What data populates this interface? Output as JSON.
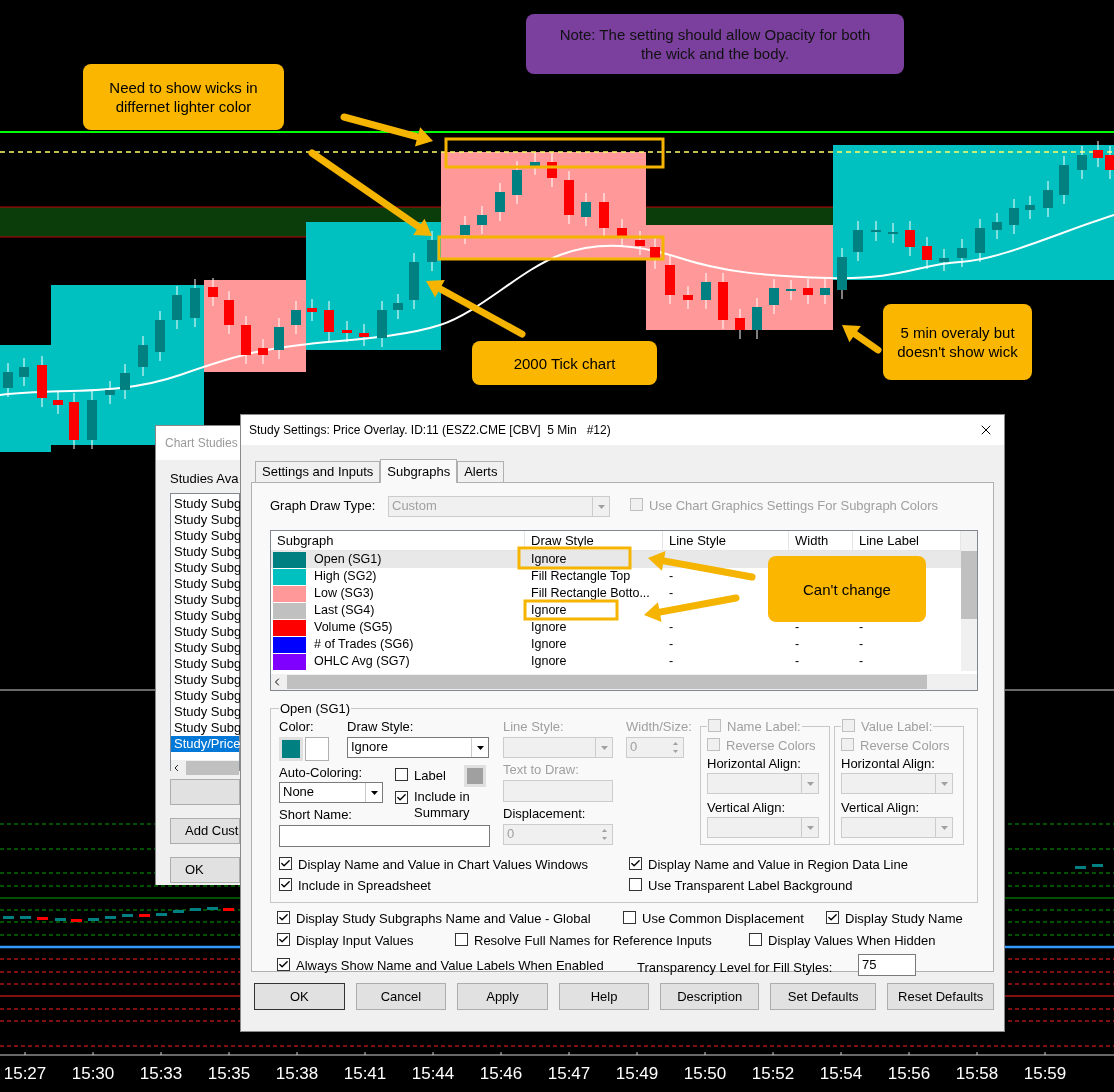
{
  "annotations": [
    {
      "kind": "callout",
      "text": "Note: The setting should allow Opacity for both the wick and the body.",
      "color": "#7b3f9e"
    },
    {
      "kind": "callout",
      "text": "Need to show wicks in differnet lighter color",
      "color": "#fbb700"
    },
    {
      "kind": "callout",
      "text": "2000 Tick chart",
      "color": "#fbb700"
    },
    {
      "kind": "callout",
      "text": "5 min overaly but doesn't show wick",
      "color": "#fbb700"
    },
    {
      "kind": "callout",
      "text": "Can't change",
      "color": "#fbb700"
    }
  ],
  "time_axis": [
    "15:27",
    "15:30",
    "15:33",
    "15:35",
    "15:38",
    "15:41",
    "15:44",
    "15:46",
    "15:47",
    "15:49",
    "15:50",
    "15:52",
    "15:54",
    "15:56",
    "15:58",
    "15:59"
  ],
  "chart_studies": {
    "title": "Chart Studies",
    "list_label": "Studies Ava",
    "items": [
      {
        "label": "Study Subg",
        "selected": false
      },
      {
        "label": "Study Subg",
        "selected": false
      },
      {
        "label": "Study Subg",
        "selected": false
      },
      {
        "label": "Study Subg",
        "selected": false
      },
      {
        "label": "Study Subg",
        "selected": false
      },
      {
        "label": "Study Subg",
        "selected": false
      },
      {
        "label": "Study Subg",
        "selected": false
      },
      {
        "label": "Study Subg",
        "selected": false
      },
      {
        "label": "Study Subg",
        "selected": false
      },
      {
        "label": "Study Subg",
        "selected": false
      },
      {
        "label": "Study Subg",
        "selected": false
      },
      {
        "label": "Study Subg",
        "selected": false
      },
      {
        "label": "Study Subg",
        "selected": false
      },
      {
        "label": "Study Subg",
        "selected": false
      },
      {
        "label": "Study Subg",
        "selected": false
      },
      {
        "label": "Study/Price",
        "selected": true
      }
    ],
    "buttons": [
      "Add Cust",
      "OK"
    ]
  },
  "study_settings": {
    "title": "Study Settings: Price Overlay. ID:11 (ESZ2.CME [CBV]  5 Min   #12)",
    "tabs": [
      {
        "label": "Settings and Inputs",
        "selected": false
      },
      {
        "label": "Subgraphs",
        "selected": true
      },
      {
        "label": "Alerts",
        "selected": false
      }
    ],
    "graph_draw_type": {
      "label": "Graph Draw Type:",
      "value": "Custom",
      "disabled": true
    },
    "use_chart_graphics": {
      "label": "Use Chart Graphics Settings For Subgraph Colors",
      "checked": false,
      "disabled": true
    },
    "table": {
      "columns": [
        "Subgraph",
        "Draw Style",
        "Line Style",
        "Width",
        "Line Label"
      ],
      "rows": [
        {
          "color": "#008080",
          "name": "Open (SG1)",
          "draw_style": "Ignore",
          "selected": true
        },
        {
          "color": "#00c0c0",
          "name": "High (SG2)",
          "draw_style": "Fill Rectangle Top",
          "line_style": "-",
          "selected": false
        },
        {
          "color": "#ff9999",
          "name": "Low (SG3)",
          "draw_style": "Fill Rectangle Botto...",
          "line_style": "-",
          "selected": false
        },
        {
          "color": "#c0c0c0",
          "name": "Last (SG4)",
          "draw_style": "Ignore",
          "selected": false
        },
        {
          "color": "#ff0000",
          "name": "Volume (SG5)",
          "draw_style": "Ignore",
          "line_style": "-",
          "width": "-",
          "line_label": "-",
          "selected": false
        },
        {
          "color": "#0000ff",
          "name": "# of Trades (SG6)",
          "draw_style": "Ignore",
          "line_style": "-",
          "width": "-",
          "line_label": "-",
          "selected": false
        },
        {
          "color": "#8000ff",
          "name": "OHLC Avg (SG7)",
          "draw_style": "Ignore",
          "line_style": "-",
          "width": "-",
          "line_label": "-",
          "selected": false
        }
      ]
    },
    "subgraph": {
      "title": "Open (SG1)",
      "color_label": "Color:",
      "color_swatches": [
        {
          "color": "#008080",
          "selected": true
        },
        {
          "color": "#ffffff",
          "selected": false
        }
      ],
      "draw_style": {
        "label": "Draw Style:",
        "value": "Ignore",
        "disabled": false
      },
      "auto_coloring": {
        "label": "Auto-Coloring:",
        "value": "None",
        "disabled": false
      },
      "label_checkbox": {
        "label": "Label",
        "checked": false,
        "disabled": false
      },
      "label_swatch": {
        "color": "#a0a0a0"
      },
      "include_in_summary": {
        "label": "Include in Summary",
        "checked": true,
        "disabled": false
      },
      "short_name": {
        "label": "Short Name:"
      },
      "line_style": {
        "label": "Line Style:",
        "disabled": true
      },
      "text_to_draw": {
        "label": "Text to Draw:",
        "disabled": true
      },
      "displacement": {
        "label": "Displacement:",
        "value": "0",
        "disabled": true
      },
      "width_size": {
        "label": "Width/Size:",
        "value": "0",
        "disabled": true
      },
      "label_groups": [
        {
          "checkbox": {
            "label": "Name Label:",
            "checked": false,
            "disabled": true
          },
          "reverse": {
            "label": "Reverse Colors",
            "checked": false,
            "disabled": true
          },
          "horizontal_label": "Horizontal Align:",
          "vertical_label": "Vertical Align:"
        },
        {
          "checkbox": {
            "label": "Value Label:",
            "checked": false,
            "disabled": true
          },
          "reverse": {
            "label": "Reverse Colors",
            "checked": false,
            "disabled": true
          },
          "horizontal_label": "Horizontal Align:",
          "vertical_label": "Vertical Align:"
        }
      ],
      "options": [
        {
          "label": "Display Name and Value in Chart Values Windows",
          "checked": true,
          "disabled": false
        },
        {
          "label": "Display Name and Value in Region Data Line",
          "checked": true,
          "disabled": false
        },
        {
          "label": "Include in Spreadsheet",
          "checked": true,
          "disabled": false
        },
        {
          "label": "Use Transparent Label Background",
          "checked": false,
          "disabled": false
        }
      ]
    },
    "global_options": [
      {
        "label": "Display Study Subgraphs Name and Value - Global",
        "checked": true,
        "disabled": false
      },
      {
        "label": "Use Common Displacement",
        "checked": false,
        "disabled": false
      },
      {
        "label": "Display Study Name",
        "checked": true,
        "disabled": false
      },
      {
        "label": "Display Input Values",
        "checked": true,
        "disabled": false
      },
      {
        "label": "Resolve Full Names for Reference Inputs",
        "checked": false,
        "disabled": false
      },
      {
        "label": "Display Values When Hidden",
        "checked": false,
        "disabled": false
      },
      {
        "label": "Always Show Name and Value Labels When Enabled",
        "checked": true,
        "disabled": false
      }
    ],
    "transparency": {
      "label": "Transparency Level for Fill Styles:",
      "value": "75"
    },
    "buttons": [
      "OK",
      "Cancel",
      "Apply",
      "Help",
      "Description",
      "Set Defaults",
      "Reset Defaults"
    ]
  }
}
